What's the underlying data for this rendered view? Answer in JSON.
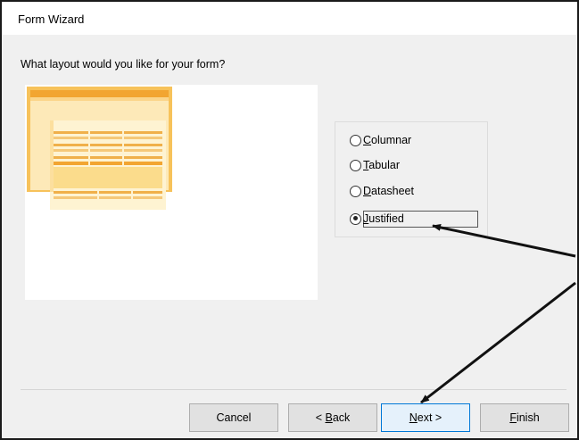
{
  "window": {
    "title": "Form Wizard"
  },
  "prompt": "What layout would you like for your form?",
  "preview": {
    "selected_layout": "Justified",
    "accent_color": "#f3b238"
  },
  "layout_options": [
    {
      "mnemonic": "C",
      "rest": "olumnar",
      "selected": false
    },
    {
      "mnemonic": "T",
      "rest": "abular",
      "selected": false
    },
    {
      "mnemonic": "D",
      "rest": "atasheet",
      "selected": false
    },
    {
      "mnemonic": "J",
      "rest": "ustified",
      "selected": true
    }
  ],
  "buttons": {
    "cancel": {
      "label": "Cancel"
    },
    "back": {
      "prefix": "< ",
      "mnemonic": "B",
      "rest": "ack"
    },
    "next": {
      "mnemonic": "N",
      "rest": "ext >"
    },
    "finish": {
      "mnemonic": "F",
      "rest": "inish"
    }
  }
}
